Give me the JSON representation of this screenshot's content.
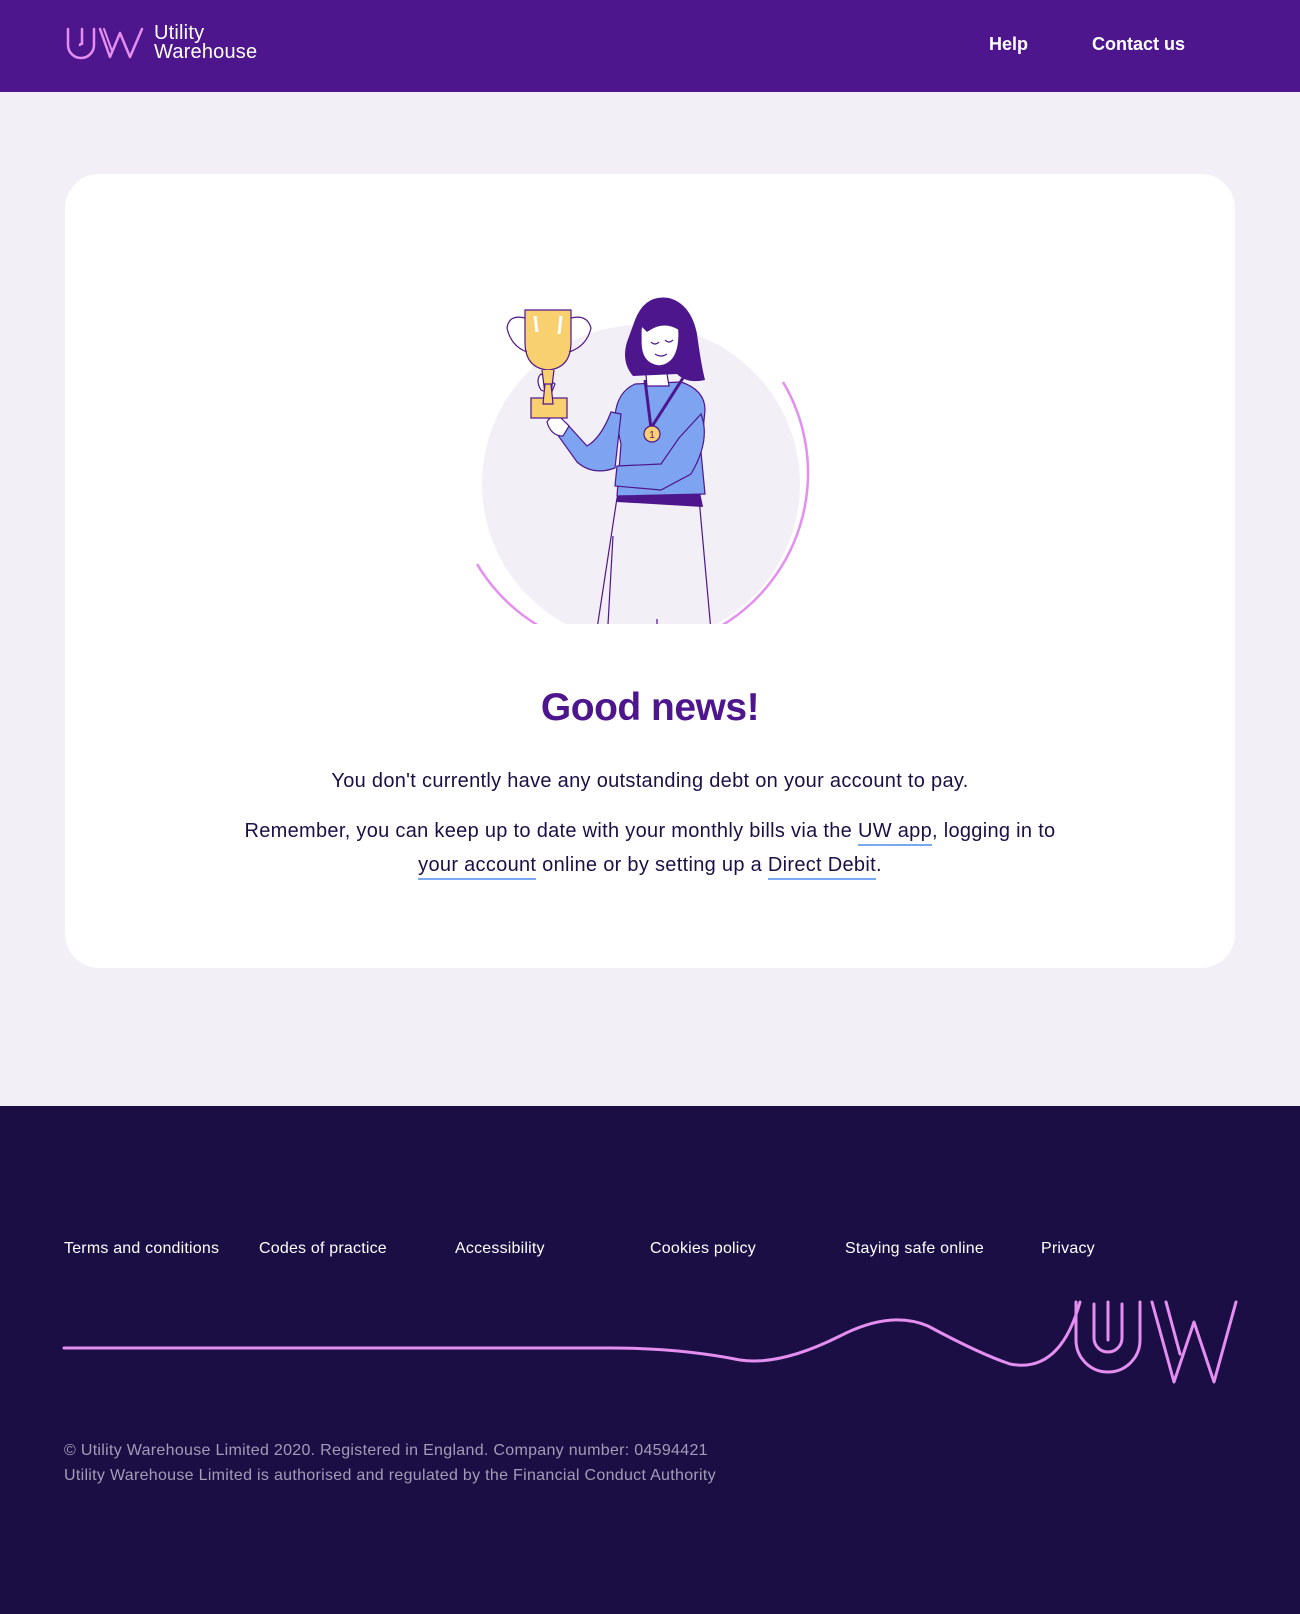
{
  "header": {
    "logo": {
      "line1": "Utility",
      "line2": "Warehouse",
      "icon": "uw-logo-icon"
    },
    "nav": [
      {
        "label": "Help"
      },
      {
        "label": "Contact us"
      }
    ]
  },
  "main": {
    "illustration": "woman-holding-trophy-illustration",
    "medal_number": "1",
    "title": "Good news!",
    "paragraph1": "You don't currently have any outstanding debt on your account to pay.",
    "paragraph2": {
      "text_before_app": "Remember, you can keep up to date with your monthly bills via the ",
      "app_link": "UW app",
      "text_after_app": ", logging in to ",
      "account_link": "your account",
      "text_middle": " online or by setting up a ",
      "dd_link": "Direct Debit",
      "text_end": "."
    }
  },
  "footer": {
    "links": [
      {
        "label": "Terms and conditions"
      },
      {
        "label": "Codes of practice"
      },
      {
        "label": "Accessibility"
      },
      {
        "label": "Cookies policy"
      },
      {
        "label": "Staying safe online"
      },
      {
        "label": "Privacy"
      }
    ],
    "copyright_line1": "© Utility Warehouse Limited 2020. Registered in England. Company number: 04594421",
    "copyright_line2": "Utility Warehouse Limited is authorised and regulated by the Financial Conduct Authority"
  },
  "colors": {
    "brand_purple": "#4e168c",
    "footer_bg": "#1a0e45",
    "page_bg": "#f2eff6",
    "accent_pink": "#e48ef0",
    "link_underline": "#7aa7ef"
  }
}
